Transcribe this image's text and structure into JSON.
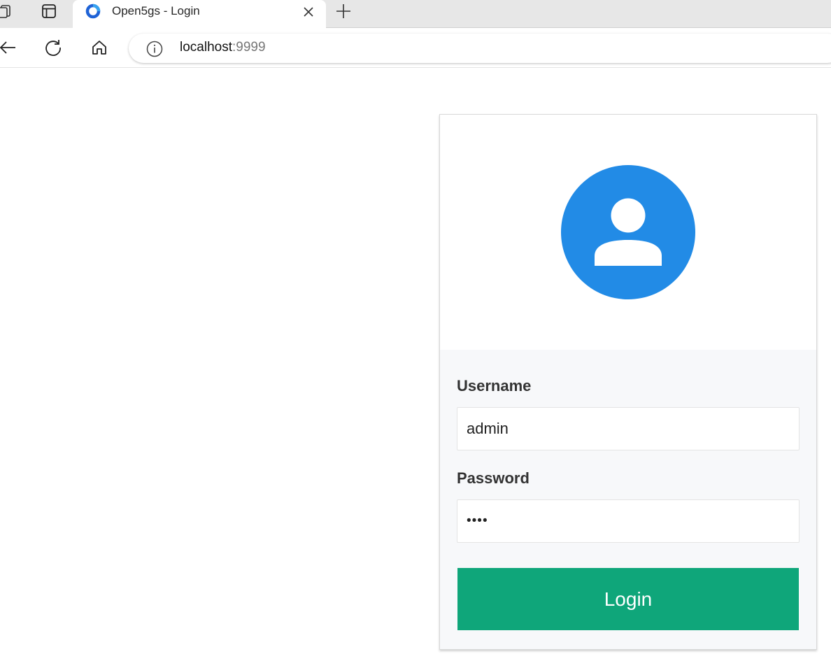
{
  "browser": {
    "tab": {
      "title": "Open5gs - Login",
      "favicon": "open5gs-ring-icon"
    },
    "address_bar": {
      "host": "localhost",
      "port": ":9999"
    },
    "icons": {
      "workspaces": "workspaces-icon",
      "tab_actions": "tab-actions-icon",
      "close_tab": "close-icon",
      "new_tab": "plus-icon",
      "back": "back-arrow-icon",
      "refresh": "refresh-icon",
      "home": "home-icon",
      "site_info": "info-icon"
    }
  },
  "login": {
    "avatar_icon": "user-avatar-icon",
    "username_label": "Username",
    "username_value": "admin",
    "password_label": "Password",
    "password_value": "••••",
    "submit_label": "Login"
  },
  "colors": {
    "avatar": "#228be6",
    "login_button": "#0fa67a",
    "form_background": "#f7f8fa"
  }
}
